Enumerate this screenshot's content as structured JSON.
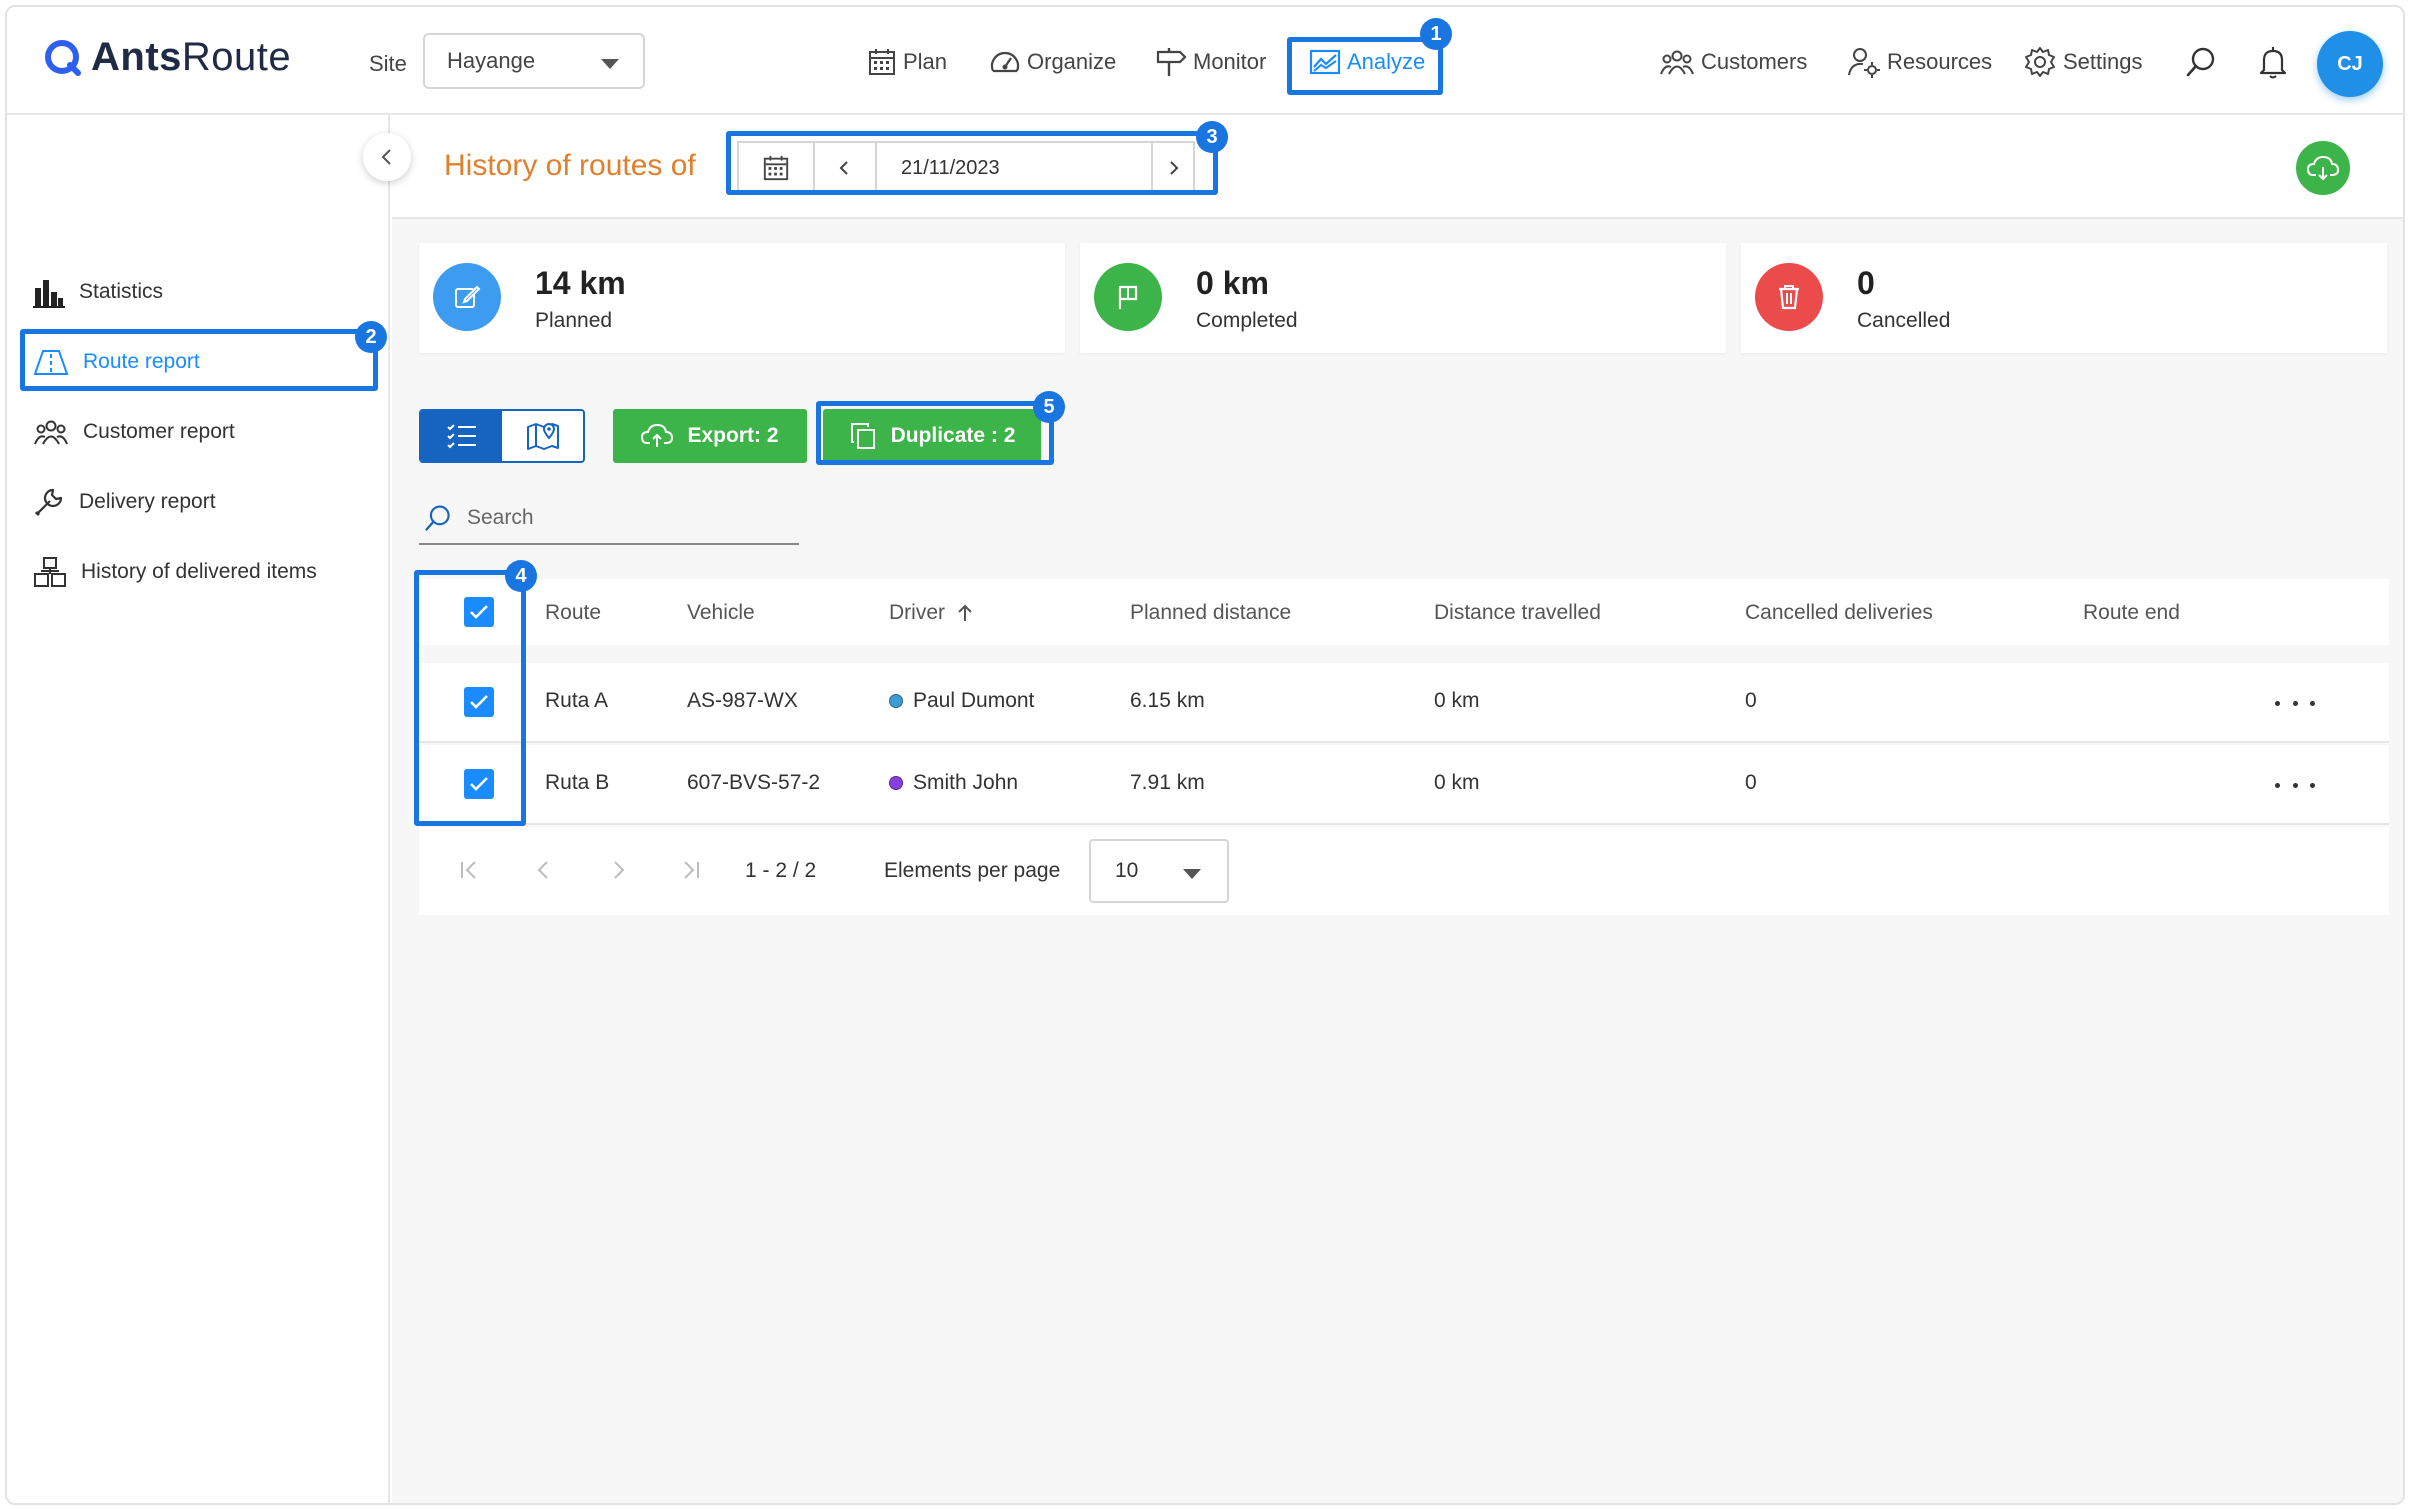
{
  "app": {
    "brand_bold": "Ants",
    "brand_light": "Route",
    "site_label": "Site",
    "site_value": "Hayange",
    "user_initials": "CJ",
    "accent_color": "#1a8cff",
    "highlight_color": "#1976e0"
  },
  "nav": {
    "plan": "Plan",
    "organize": "Organize",
    "monitor": "Monitor",
    "analyze": "Analyze",
    "customers": "Customers",
    "resources": "Resources",
    "settings": "Settings"
  },
  "sidebar": {
    "items": [
      {
        "label": "Statistics",
        "icon": "bar-chart-icon"
      },
      {
        "label": "Route report",
        "icon": "road-icon"
      },
      {
        "label": "Customer report",
        "icon": "people-icon"
      },
      {
        "label": "Delivery report",
        "icon": "wrench-icon"
      },
      {
        "label": "History of delivered items",
        "icon": "boxes-icon"
      }
    ]
  },
  "header": {
    "title": "History of routes of",
    "date": "21/11/2023"
  },
  "stats": [
    {
      "value": "14 km",
      "label": "Planned",
      "color": "#3d9bf0"
    },
    {
      "value": "0 km",
      "label": "Completed",
      "color": "#3cb449"
    },
    {
      "value": "0",
      "label": "Cancelled",
      "color": "#ec4b4b"
    }
  ],
  "actions": {
    "export": "Export: 2",
    "duplicate": "Duplicate : 2"
  },
  "search": {
    "placeholder": "Search"
  },
  "table": {
    "headers": {
      "route": "Route",
      "vehicle": "Vehicle",
      "driver": "Driver",
      "planned": "Planned distance",
      "travelled": "Distance travelled",
      "cancelled": "Cancelled deliveries",
      "route_end": "Route end"
    },
    "rows": [
      {
        "route": "Ruta A",
        "vehicle": "AS-987-WX",
        "driver": "Paul Dumont",
        "driver_color": "#3d9bd0",
        "planned": "6.15 km",
        "travelled": "0 km",
        "cancelled": "0",
        "checked": true
      },
      {
        "route": "Ruta B",
        "vehicle": "607-BVS-57-2",
        "driver": "Smith John",
        "driver_color": "#8a3ee0",
        "planned": "7.91 km",
        "travelled": "0 km",
        "cancelled": "0",
        "checked": true
      }
    ]
  },
  "pagination": {
    "range": "1 - 2 / 2",
    "per_page_label": "Elements per page",
    "per_page_value": "10"
  },
  "callouts": [
    "1",
    "2",
    "3",
    "4",
    "5"
  ]
}
